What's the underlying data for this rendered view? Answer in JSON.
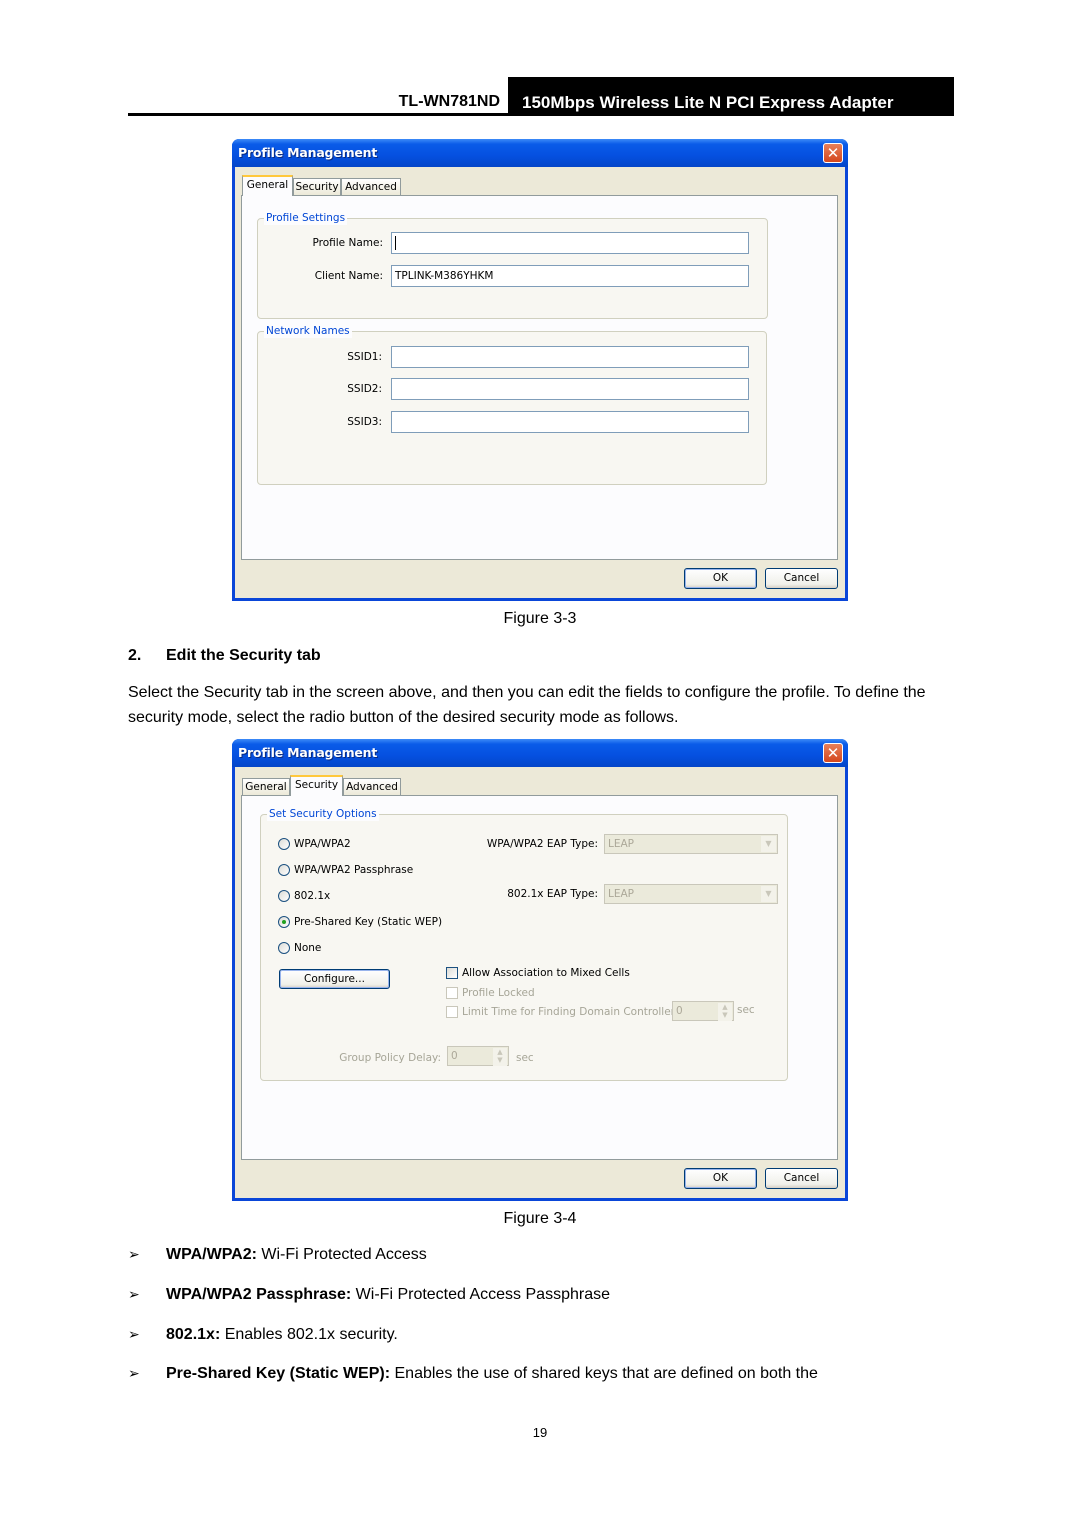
{
  "header": {
    "model": "TL-WN781ND",
    "product": "150Mbps Wireless Lite N PCI Express Adapter"
  },
  "figure1": {
    "window_title": "Profile Management",
    "close_icon": "close-icon",
    "tabs": [
      {
        "label": "General",
        "active": true
      },
      {
        "label": "Security",
        "active": false
      },
      {
        "label": "Advanced",
        "active": false
      }
    ],
    "profile_settings": {
      "legend": "Profile Settings",
      "profile_name_label": "Profile Name:",
      "profile_name_value": "",
      "client_name_label": "Client Name:",
      "client_name_value": "TPLINK-M386YHKM"
    },
    "network_names": {
      "legend": "Network Names",
      "ssid1_label": "SSID1:",
      "ssid1_value": "",
      "ssid2_label": "SSID2:",
      "ssid2_value": "",
      "ssid3_label": "SSID3:",
      "ssid3_value": ""
    },
    "ok_label": "OK",
    "cancel_label": "Cancel",
    "caption": "Figure 3-3"
  },
  "section": {
    "number": "2.",
    "title": "Edit the Security tab",
    "paragraph": "Select the Security tab in the screen above, and then you can edit the fields to configure the profile. To define the security mode, select the radio button of the desired security mode as follows."
  },
  "figure2": {
    "window_title": "Profile Management",
    "tabs": [
      {
        "label": "General",
        "active": false
      },
      {
        "label": "Security",
        "active": true
      },
      {
        "label": "Advanced",
        "active": false
      }
    ],
    "security_options": {
      "legend": "Set Security Options",
      "radios": [
        {
          "label": "WPA/WPA2",
          "selected": false
        },
        {
          "label": "WPA/WPA2 Passphrase",
          "selected": false
        },
        {
          "label": "802.1x",
          "selected": false
        },
        {
          "label": "Pre-Shared Key (Static WEP)",
          "selected": true
        },
        {
          "label": "None",
          "selected": false
        }
      ],
      "wpa_eap_label": "WPA/WPA2 EAP Type:",
      "wpa_eap_value": "LEAP",
      "dot1x_eap_label": "802.1x EAP Type:",
      "dot1x_eap_value": "LEAP",
      "configure_label": "Configure...",
      "checkboxes": [
        {
          "label": "Allow Association to Mixed Cells",
          "checked": false,
          "enabled": true
        },
        {
          "label": "Profile Locked",
          "checked": false,
          "enabled": false
        },
        {
          "label": "Limit Time for Finding Domain Controller To:",
          "checked": false,
          "enabled": false
        }
      ],
      "domain_timeout_value": "0",
      "domain_timeout_unit": "sec",
      "group_policy_label": "Group Policy Delay:",
      "group_policy_value": "0",
      "group_policy_unit": "sec"
    },
    "ok_label": "OK",
    "cancel_label": "Cancel",
    "caption": "Figure 3-4"
  },
  "bullets": [
    {
      "term": "WPA/WPA2:",
      "desc": " Wi-Fi Protected Access"
    },
    {
      "term": "WPA/WPA2 Passphrase:",
      "desc": " Wi-Fi Protected Access Passphrase"
    },
    {
      "term": "802.1x:",
      "desc": " Enables 802.1x security."
    },
    {
      "term": "Pre-Shared Key (Static WEP):",
      "desc": " Enables the use of shared keys that are defined on both the"
    }
  ],
  "bullet_mark": "➢",
  "page_number": "19"
}
